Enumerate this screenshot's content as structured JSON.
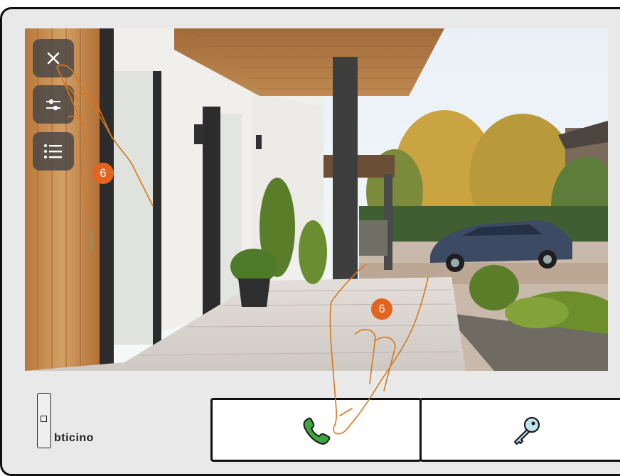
{
  "brand": {
    "name": "bticino"
  },
  "callouts": {
    "top_number": "6",
    "bottom_number": "6"
  },
  "icons": {
    "close": "close-icon",
    "settings": "sliders-icon",
    "menu": "list-icon",
    "answer": "phone-handset-icon",
    "door": "key-icon"
  },
  "colors": {
    "callout": "#e3641f",
    "hand_outline": "#d6781e",
    "phone_green": "#3ea53f",
    "key_outline": "#1a1a1a"
  }
}
